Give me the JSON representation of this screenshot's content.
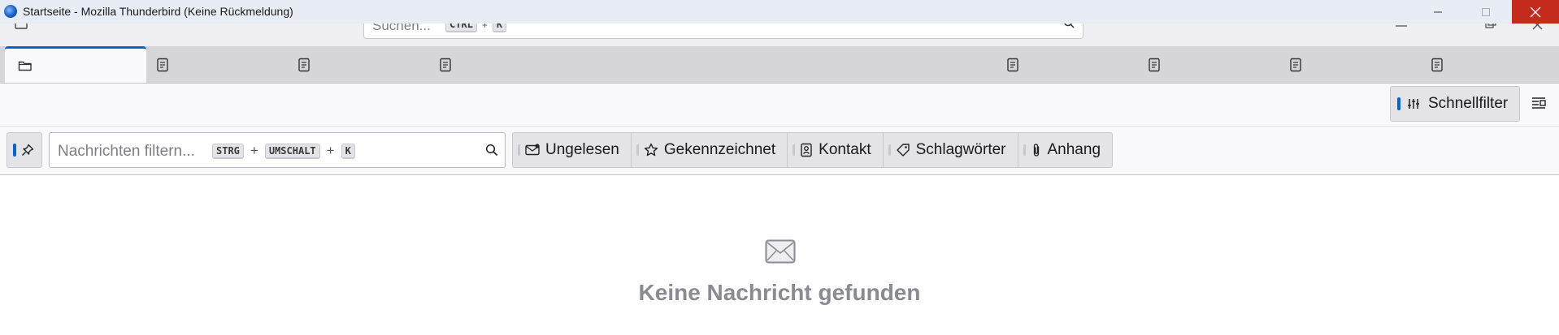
{
  "window": {
    "title": "Startseite - Mozilla Thunderbird (Keine Rückmeldung)"
  },
  "toolbar": {
    "search_placeholder": "Suchen...",
    "search_key_ctrl": "CTRL",
    "search_key_plus": "+",
    "search_key_k": "K"
  },
  "tabs": [
    {
      "icon": "folder-icon",
      "selected": true
    },
    {
      "icon": "document-icon",
      "selected": false
    },
    {
      "icon": "document-icon",
      "selected": false
    },
    {
      "icon": "document-icon",
      "selected": false
    },
    {
      "icon": "document-icon",
      "selected": false
    },
    {
      "icon": "document-icon",
      "selected": false
    },
    {
      "icon": "document-icon",
      "selected": false
    },
    {
      "icon": "document-icon",
      "selected": false
    }
  ],
  "quick_filter_toggle": {
    "label": "Schnellfilter"
  },
  "filter": {
    "placeholder": "Nachrichten filtern...",
    "key1": "STRG",
    "plus": "+",
    "key2": "UMSCHALT",
    "key3": "K"
  },
  "filter_buttons": [
    {
      "label": "Ungelesen",
      "icon": "envelope-icon"
    },
    {
      "label": "Gekennzeichnet",
      "icon": "star-icon"
    },
    {
      "label": "Kontakt",
      "icon": "contact-icon"
    },
    {
      "label": "Schlagwörter",
      "icon": "tag-icon"
    },
    {
      "label": "Anhang",
      "icon": "paperclip-icon"
    }
  ],
  "empty_state": {
    "message": "Keine Nachricht gefunden"
  },
  "colors": {
    "accent": "#0a64c8",
    "close_button": "#c42b1c"
  }
}
